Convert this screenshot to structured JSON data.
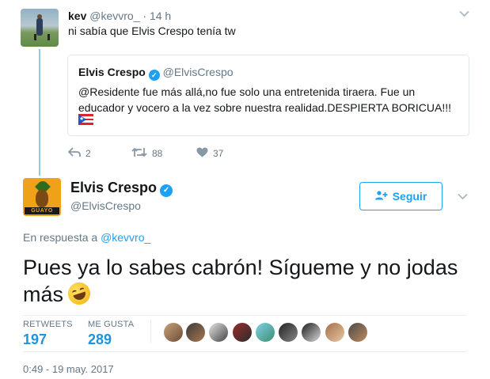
{
  "parent_tweet": {
    "name": "kev",
    "handle": "@kevvro_",
    "separator": "·",
    "time": "14 h",
    "text": "ni sabía que Elvis Crespo tenía tw",
    "quote": {
      "name": "Elvis Crespo",
      "handle": "@ElvisCrespo",
      "text": "@Residente fue más allá,no fue solo una entretenida tiraera. Fue un educador y vocero a la vez sobre nuestra realidad.DESPIERTA BORICUA!!!"
    },
    "actions": {
      "reply_count": "2",
      "retweet_count": "88",
      "like_count": "37"
    }
  },
  "main_tweet": {
    "name": "Elvis Crespo",
    "handle": "@ElvisCrespo",
    "avatar_text": "GUAYO",
    "follow_label": "Seguir",
    "reply_to_prefix": "En respuesta a",
    "reply_to_handle": "@kevvro_",
    "text": "Pues ya lo sabes cabrón! Sígueme y no jodas más",
    "retweets_label": "RETWEETS",
    "retweets_value": "197",
    "likes_label": "ME GUSTA",
    "likes_value": "289",
    "timestamp": "0:49 - 19 may. 2017"
  },
  "colors": {
    "accent": "#1da1f2",
    "count_blue": "#1b95e0",
    "thread_line": "#90cae9",
    "muted": "#657786"
  },
  "icons": {
    "reply": "reply-icon",
    "retweet": "retweet-icon",
    "like": "heart-icon",
    "verified": "verified-badge-icon",
    "follow": "add-user-icon",
    "menu": "chevron-down-icon"
  }
}
